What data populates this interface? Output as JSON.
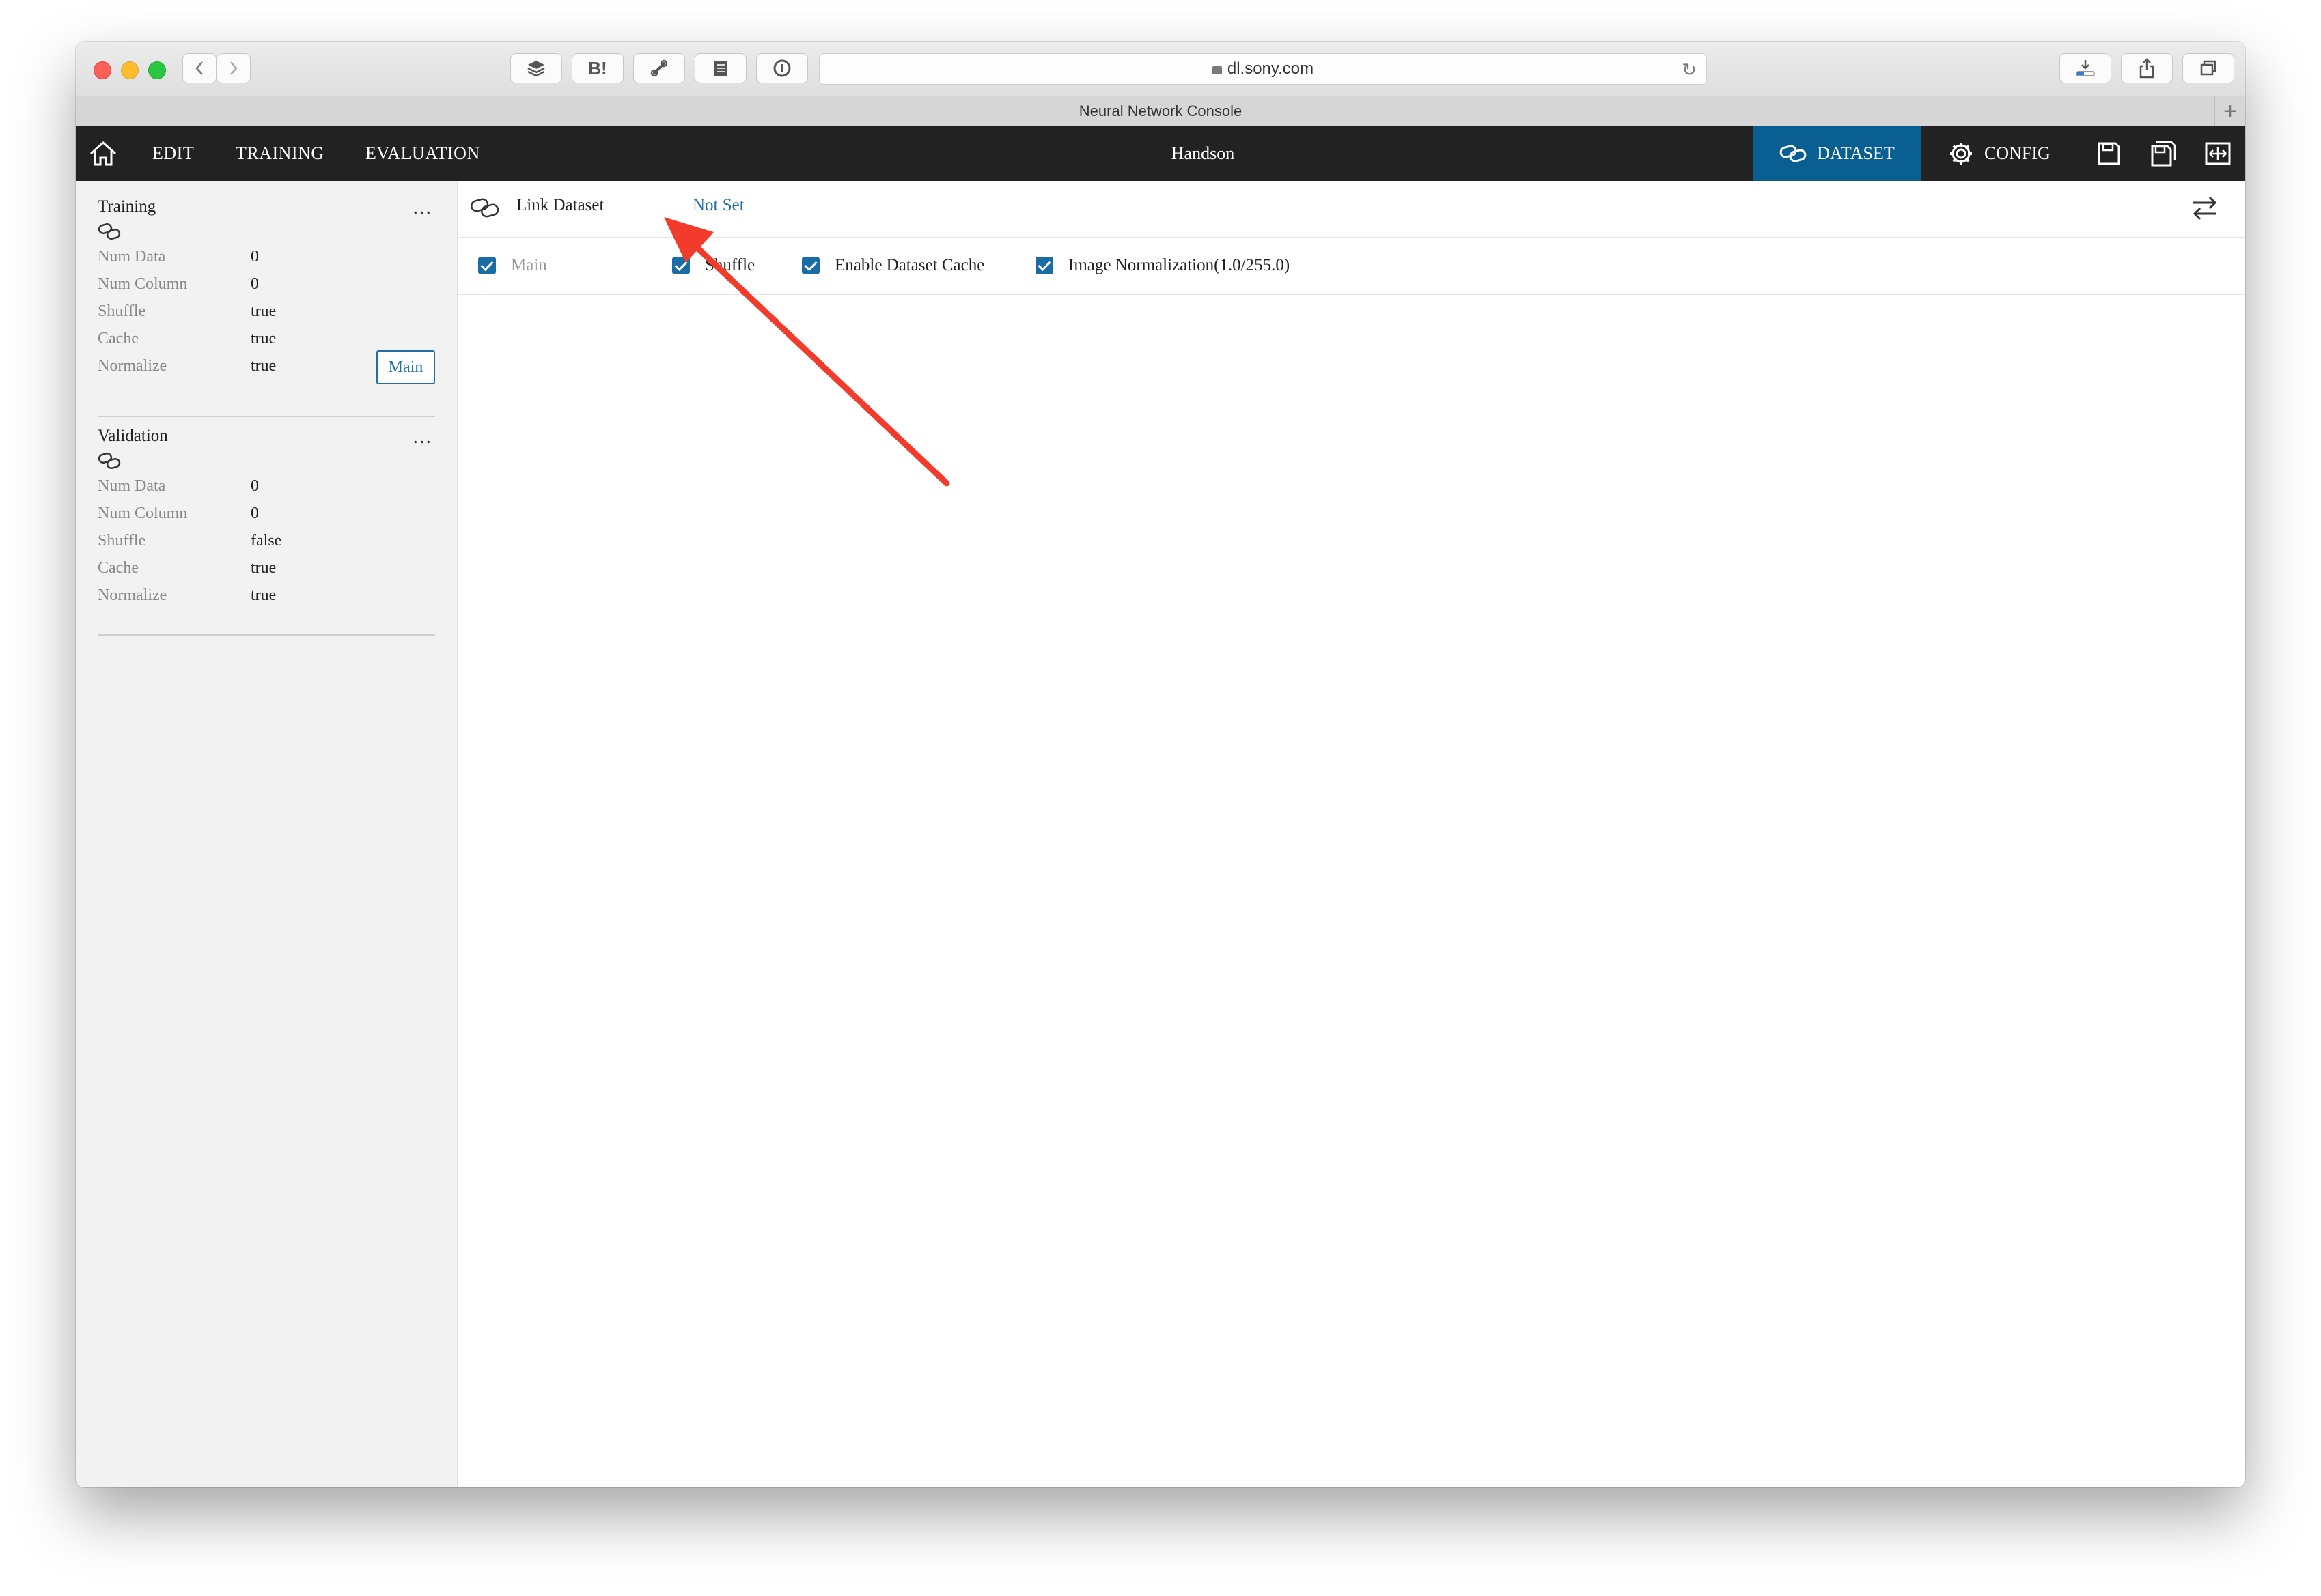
{
  "browser": {
    "url": "dl.sony.com",
    "tab_title": "Neural Network Console",
    "bookmark_b_label": "B!"
  },
  "appbar": {
    "nav": [
      "EDIT",
      "TRAINING",
      "EVALUATION"
    ],
    "project_title": "Handson",
    "dataset_tab": "DATASET",
    "config_tab": "CONFIG",
    "active_color": "#0a5f92"
  },
  "sidebar": {
    "training": {
      "title": "Training",
      "more": "...",
      "rows": [
        {
          "label": "Num Data",
          "value": "0"
        },
        {
          "label": "Num Column",
          "value": "0"
        },
        {
          "label": "Shuffle",
          "value": "true"
        },
        {
          "label": "Cache",
          "value": "true"
        },
        {
          "label": "Normalize",
          "value": "true"
        }
      ],
      "main_button": "Main"
    },
    "validation": {
      "title": "Validation",
      "more": "...",
      "rows": [
        {
          "label": "Num Data",
          "value": "0"
        },
        {
          "label": "Num Column",
          "value": "0"
        },
        {
          "label": "Shuffle",
          "value": "false"
        },
        {
          "label": "Cache",
          "value": "true"
        },
        {
          "label": "Normalize",
          "value": "true"
        }
      ]
    }
  },
  "main": {
    "link_label": "Link Dataset",
    "link_value": "Not Set",
    "options": [
      {
        "label": "Main",
        "checked": true,
        "enabled": false
      },
      {
        "label": "Shuffle",
        "checked": true,
        "enabled": true
      },
      {
        "label": "Enable Dataset Cache",
        "checked": true,
        "enabled": true
      },
      {
        "label": "Image Normalization(1.0/255.0)",
        "checked": true,
        "enabled": true
      }
    ]
  },
  "annotation": {
    "color": "#f23b2a"
  }
}
